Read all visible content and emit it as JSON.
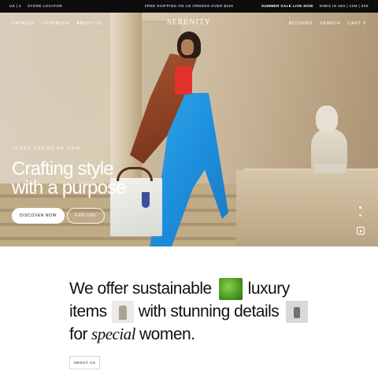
{
  "announcement": {
    "locale": "UK | £",
    "store_locator": "Store Locator",
    "shipping": "Free shipping on US orders over $150",
    "sale_live": "Summer sale live now",
    "countdown": "Ends in 16h | 12m | 20s"
  },
  "nav": {
    "logo": "SERENITY",
    "left": [
      "Catalog",
      "Lookbook",
      "About us"
    ],
    "account": "Account",
    "search": "Search",
    "cart": "Cart",
    "cart_count": "0"
  },
  "hero": {
    "eyebrow": "Class can be an item",
    "headline_line1": "Crafting style",
    "headline_line2": "with a purpose",
    "primary_cta": "Discover now",
    "secondary_cta": "Explore"
  },
  "statement": {
    "row1_a": "We offer sustainable",
    "row1_b": "luxury",
    "row2_a": "items",
    "row2_b": "with stunning details",
    "row3_a": "for",
    "row3_special": "special",
    "row3_b": "women."
  },
  "about_button": "About us",
  "icons": {
    "play": "play-icon",
    "thumb_leaf": "leaf-image",
    "thumb_coat": "coat-image",
    "thumb_detail": "bag-detail-image"
  }
}
